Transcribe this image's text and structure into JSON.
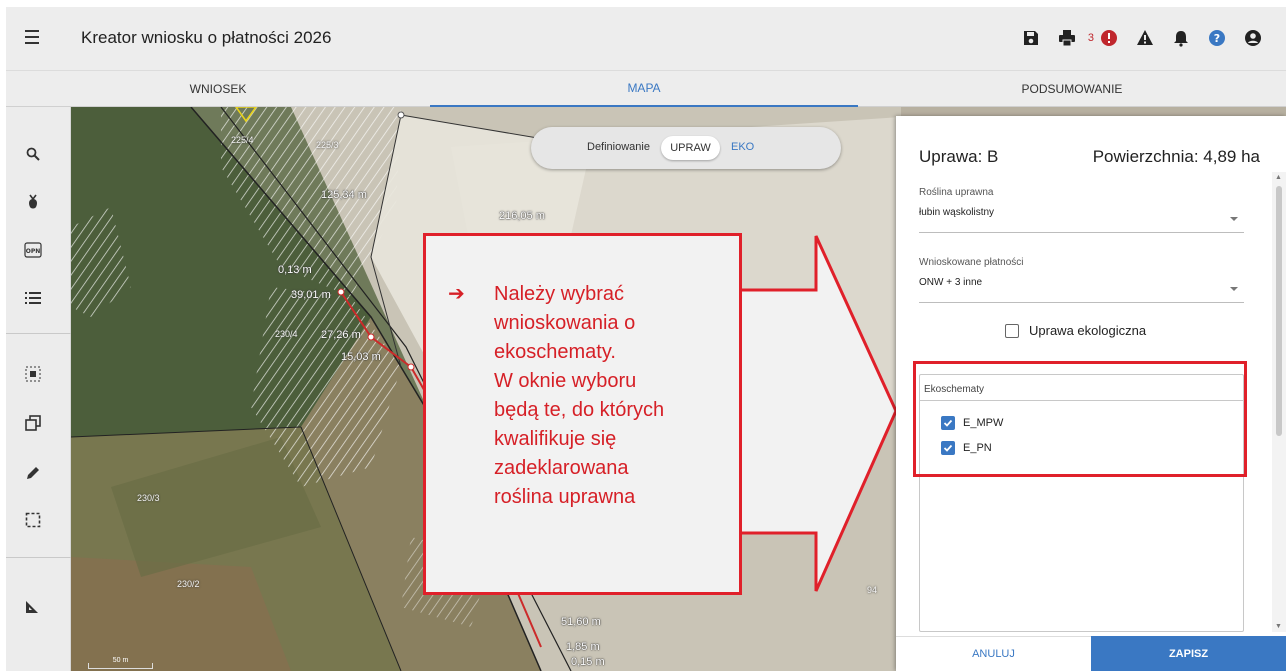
{
  "app": {
    "title": "Kreator wniosku o płatności 2026"
  },
  "toolbar": {
    "icons": [
      "save-icon",
      "print-icon",
      "error-icon",
      "warning-icon",
      "bell-icon",
      "help-icon",
      "account-icon"
    ],
    "error_count": "3"
  },
  "tabs": [
    {
      "label": "WNIOSEK",
      "active": false
    },
    {
      "label": "MAPA",
      "active": true
    },
    {
      "label": "PODSUMOWANIE",
      "active": false
    }
  ],
  "rail": {
    "icons": [
      "search-icon",
      "crop-marker-icon",
      "opn-icon",
      "list-icon",
      "select-area-icon",
      "copy-icon",
      "pencil-icon",
      "dashed-select-icon",
      "ruler-icon"
    ],
    "opn_text": "OPN"
  },
  "map": {
    "mode_toggle": {
      "label": "Definiowanie",
      "option_active": "UPRAW",
      "option_other": "EKO"
    },
    "parcels": [
      "225/4",
      "225/3",
      "230/4",
      "230/3",
      "230/2",
      "94"
    ],
    "distances": [
      "125,34 m",
      "216,05 m",
      "0,13 m",
      "39,01 m",
      "27,26 m",
      "15,03 m",
      "51,60 m",
      "1,85 m",
      "0,15 m"
    ],
    "scale": "50 m"
  },
  "callout": {
    "arrow": "➔",
    "lines": [
      "Należy wybrać",
      "wnioskowania o",
      "ekoschematy.",
      "W oknie wyboru",
      "będą te, do których",
      "kwalifikuje się",
      "zadeklarowana",
      "roślina uprawna"
    ]
  },
  "panel": {
    "title": "Uprawa: B",
    "area": "Powierzchnia: 4,89 ha",
    "crop": {
      "label": "Roślina uprawna",
      "value": "łubin wąskolistny"
    },
    "payments": {
      "label": "Wnioskowane płatności",
      "value": "ONW + 3 inne"
    },
    "organic_label": "Uprawa ekologiczna",
    "organic_checked": false,
    "ekoschematy": {
      "label": "Ekoschematy",
      "items": [
        {
          "label": "E_MPW",
          "checked": true
        },
        {
          "label": "E_PN",
          "checked": true
        }
      ]
    },
    "buttons": {
      "cancel": "ANULUJ",
      "save": "ZAPISZ"
    }
  },
  "colors": {
    "accent": "#3a78c3",
    "callout_red": "#e0202a",
    "error_red": "#c0272d"
  }
}
